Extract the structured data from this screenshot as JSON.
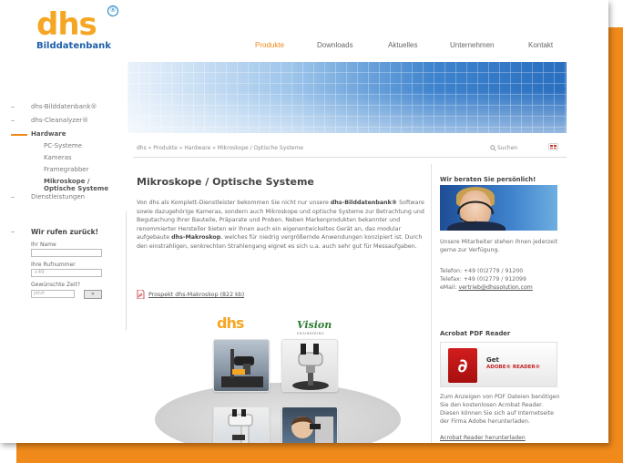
{
  "brand": {
    "logo_word": "dhs",
    "logo_registered": "®",
    "logo_sub": "Bilddatenbank",
    "accent": "#f08a1a",
    "brand_blue": "#1d5fa8"
  },
  "topnav": {
    "items": [
      "Produkte",
      "Downloads",
      "Aktuelles",
      "Unternehmen",
      "Kontakt"
    ],
    "active": "Produkte"
  },
  "sidebar": {
    "items": [
      {
        "label": "dhs-Bilddatenbank®"
      },
      {
        "label": "dhs-Cleanalyzer®"
      },
      {
        "label": "Hardware"
      },
      {
        "label": "PC-Systeme"
      },
      {
        "label": "Kameras"
      },
      {
        "label": "Framegrabber"
      },
      {
        "label": "Mikroskope /"
      },
      {
        "label": "Optische Systeme"
      },
      {
        "label": "Dienstleistungen"
      }
    ],
    "callback": {
      "title": "Wir rufen zurück!",
      "name_label": "Ihr Name",
      "phone_label": "Ihre Rufnummer",
      "phone_placeholder": "+49",
      "time_label": "Gewünschte Zeit?",
      "time_placeholder": "jetzt",
      "submit": "»"
    }
  },
  "breadcrumb": {
    "path": "dhs » Produkte » Hardware » Mikroskope / Optische Systeme",
    "search": "Suchen"
  },
  "main": {
    "title": "Mikroskope / Optische Systeme",
    "para": {
      "p1": "Von dhs als Komplett-Dienstleister bekommen Sie nicht nur unsere",
      "b1": "dhs-Bilddatenbank®",
      "p2": " Software sowie dazugehörige Kameras, sondern auch Mikroskope und optische Systeme zur Betrachtung und Begutachung Ihrer Bauteile, Präparate und Proben. Neben Markenprodukten bekannter und renommierter Hersteller bieten wir Ihnen auch ein eigenentwickeltes Gerät an, das modular aufgebaute ",
      "b2": "dhs-Makroskop",
      "p3": ", welches für niedrig vergrößernde Anwendungen konzipiert ist. Durch den einstrahligen, senkrechten Strahlengang eignet es sich u.a. auch sehr gut für Messaufgaben."
    },
    "pdf_link": "Prospekt dhs-Makroskop (822 kb)",
    "product_logo_dhs": "dhs",
    "product_logo_vision": "Vision",
    "product_logo_vision_sub": "ENGINEERING"
  },
  "right_column": {
    "advice_title": "Wir beraten Sie persönlich!",
    "advice_text": "Unsere Mitarbeiter stehen Ihnen jederzeit gerne zur Verfügung.",
    "phone": "Telefon: +49 (0)2779 / 91200",
    "fax": "Telefax: +49 (0)2779 / 912099",
    "email_label": "eMail: ",
    "email": "vertrieb@dhssolution.com",
    "acrobat_title": "Acrobat PDF Reader",
    "adobe_get": "Get",
    "adobe_reader": "ADOBE® READER®",
    "acrobat_text": "Zum Anzeigen von PDF Dateien benötigen Sie den kostenlosen Acrobat Reader. Diesen können Sie sich auf Internetseite der Firma Adobe herunterladen.",
    "acrobat_link": "Acrobat Reader herunterladen"
  }
}
